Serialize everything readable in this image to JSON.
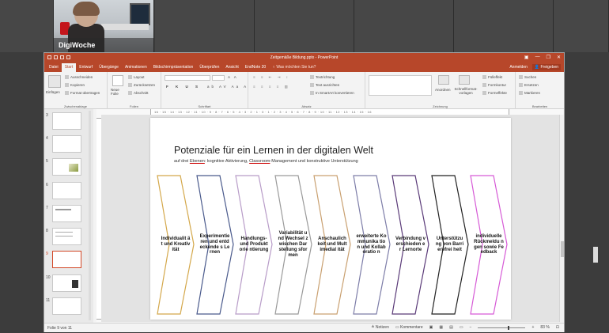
{
  "conference": {
    "participant_name": "DigiWoche"
  },
  "window": {
    "title": "Zeitgemäße Bildung.pptx - PowerPoint"
  },
  "tabs": [
    {
      "label": "Datei"
    },
    {
      "label": "Start"
    },
    {
      "label": "Entwurf"
    },
    {
      "label": "Übergänge"
    },
    {
      "label": "Animationen"
    },
    {
      "label": "Bildschirmpräsentation"
    },
    {
      "label": "Überprüfen"
    },
    {
      "label": "Ansicht"
    },
    {
      "label": "EndNote 20"
    }
  ],
  "tellme": "Was möchten Sie tun?",
  "account": {
    "signin": "Anmelden",
    "share": "Freigeben"
  },
  "ribbon": {
    "clipboard": {
      "paste": "Einfügen",
      "cut": "Ausschneiden",
      "copy": "Kopieren",
      "format_painter": "Format übertragen",
      "label": "Zwischenablage"
    },
    "slides": {
      "new_slide": "Neue Folie",
      "layout": "Layout",
      "reset": "Zurücksetzen",
      "section": "Abschnitt",
      "label": "Folien"
    },
    "font": {
      "label": "Schriftart"
    },
    "paragraph": {
      "text_direction": "Textrichtung",
      "align_text": "Text ausrichten",
      "smartart": "In SmartArt konvertieren",
      "label": "Absatz"
    },
    "drawing": {
      "arrange": "Anordnen",
      "quick_styles": "Schnellformat-vorlagen",
      "fill": "Fülleffekt",
      "outline": "Formkontur",
      "effects": "Formeffekte",
      "label": "Zeichnung"
    },
    "editing": {
      "find": "Suchen",
      "replace": "Ersetzen",
      "select": "Markieren",
      "label": "Bearbeiten"
    }
  },
  "ruler_ticks": "16 · 15 · 14 · 13 · 12 · 11 · 10 · 9 · 8 · 7 · 6 · 5 · 4 · 3 · 2 · 1 · 0 · 1 · 2 · 3 · 4 · 5 · 6 · 7 · 8 · 9 · 10 · 11 · 12 · 13 · 14 · 15 · 16",
  "thumbnails": [
    {
      "num": "3"
    },
    {
      "num": "4"
    },
    {
      "num": "5"
    },
    {
      "num": "6"
    },
    {
      "num": "7"
    },
    {
      "num": "8"
    },
    {
      "num": "9"
    },
    {
      "num": "10"
    },
    {
      "num": "11"
    }
  ],
  "slide": {
    "title": "Potenziale für ein Lernen in der digitalen Welt",
    "subtitle_prefix": "auf drei ",
    "subtitle_ebenen": "Ebenen",
    "subtitle_mid": ": kognitive Aktivierung, ",
    "subtitle_classroom": "Classroom",
    "subtitle_suffix": "-Management und konstruktive Unterstützung",
    "shapes": [
      {
        "label": "Individualit ät und Kreativität",
        "color": "#d4a84b"
      },
      {
        "label": "Experimentie ren und entdeckende s Lernen",
        "color": "#4a5a8c"
      },
      {
        "label": "Handlungs- und Produktorie ntierung",
        "color": "#b89cc8"
      },
      {
        "label": "Variabilität und Wechsel zwischen Darstellung sformen",
        "color": "#9a9a9a"
      },
      {
        "label": "Anschaulich keit und Multimedial ität",
        "color": "#c9a070"
      },
      {
        "label": "erweiterte Kommunika tion und Kollaboratio n",
        "color": "#7d7da8"
      },
      {
        "label": "Verbindung verschieden er Lernorte",
        "color": "#5a3a78"
      },
      {
        "label": "Unterstützu ng von Barrierefrei heit",
        "color": "#222222"
      },
      {
        "label": "individuelle Rückmeldu ngen sowie Feedback",
        "color": "#d65ad6"
      }
    ]
  },
  "status": {
    "slide_info": "Folie 9 von 11",
    "notes": "Notizen",
    "comments": "Kommentare",
    "zoom": "83 %"
  }
}
